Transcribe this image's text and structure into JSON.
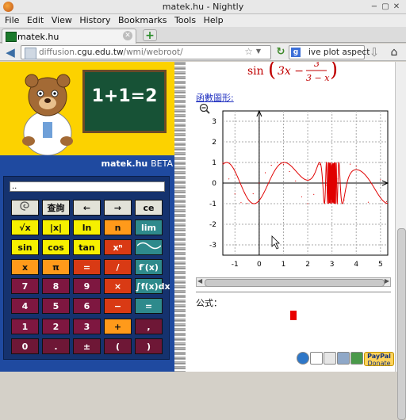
{
  "window": {
    "title": "matek.hu - Nightly"
  },
  "menu": [
    "File",
    "Edit",
    "View",
    "History",
    "Bookmarks",
    "Tools",
    "Help"
  ],
  "tab": {
    "title": "matek.hu",
    "new_tab_label": "+"
  },
  "nav": {
    "url_prefix": "diffusion.",
    "url_host": "cgu.edu.tw",
    "url_path": "/wmi/webroot/",
    "search_text": "ive plot aspect",
    "search_engine": "g"
  },
  "logo": {
    "board_text": "1+1=2",
    "brand": "matek.hu",
    "beta": "BETA"
  },
  "calc": {
    "display": "..",
    "keys": [
      [
        "",
        "查詢",
        "←",
        "→",
        "ce"
      ],
      [
        "√x",
        "|x|",
        "ln",
        "n",
        "lim aₙ"
      ],
      [
        "sin",
        "cos",
        "tan",
        "xⁿ",
        ""
      ],
      [
        "x",
        "π",
        "=",
        "/",
        "f′(x)"
      ],
      [
        "7",
        "8",
        "9",
        "×",
        "∫f(x)dx"
      ],
      [
        "4",
        "5",
        "6",
        "−",
        "="
      ],
      [
        "1",
        "2",
        "3",
        "+",
        ","
      ],
      [
        "0",
        ".",
        "±",
        "(",
        ")"
      ]
    ]
  },
  "formula_display": {
    "main": "sin",
    "arg": "3x −",
    "num": "3",
    "den": "3 − x"
  },
  "graph_link": "函數圖形:",
  "formula_label": "公式：",
  "paypal": {
    "brand": "PayPal",
    "sub": "Donate"
  },
  "colors": {
    "accent": "#e00000",
    "panel_blue": "#1f4aa0",
    "logo_yellow": "#fcd200"
  },
  "chart_data": {
    "type": "line",
    "title": "",
    "xlabel": "",
    "ylabel": "",
    "xlim": [
      -1.5,
      5.3
    ],
    "ylim": [
      -3.5,
      3.5
    ],
    "xticks": [
      -1,
      0,
      1,
      2,
      3,
      4,
      5
    ],
    "yticks": [
      -3,
      -2,
      -1,
      0,
      1,
      2,
      3
    ],
    "grid": true,
    "function": "sin(3x - 3/(3 - x))",
    "series": [
      {
        "values": [
          [
            -1.5,
            0.99
          ],
          [
            -1.25,
            0.2
          ],
          [
            -1.0,
            -0.53
          ],
          [
            -0.75,
            -0.95
          ],
          [
            -0.5,
            -0.99
          ],
          [
            -0.25,
            -0.52
          ],
          [
            0.0,
            0.0
          ],
          [
            0.25,
            0.5
          ],
          [
            0.5,
            0.86
          ],
          [
            0.75,
            1.0
          ],
          [
            1.0,
            0.91
          ],
          [
            1.25,
            0.56
          ],
          [
            1.5,
            0.1
          ],
          [
            1.75,
            -0.67
          ],
          [
            2.0,
            -1.0
          ],
          [
            2.25,
            -0.55
          ],
          [
            2.5,
            0.9
          ],
          [
            2.75,
            -0.1
          ],
          [
            3.25,
            0.2
          ],
          [
            3.5,
            -0.82
          ],
          [
            3.75,
            0.92
          ],
          [
            4.0,
            0.81
          ],
          [
            4.5,
            -0.93
          ],
          [
            5.0,
            0.16
          ],
          [
            5.25,
            -0.9
          ]
        ]
      }
    ]
  }
}
